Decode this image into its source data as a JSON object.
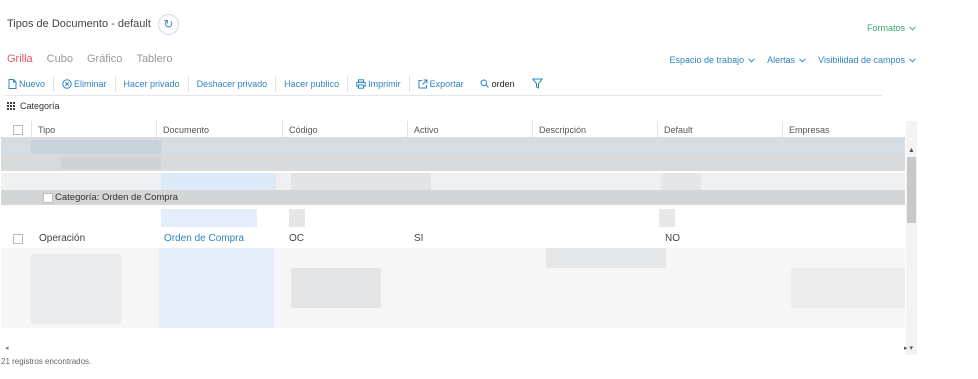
{
  "page": {
    "title": "Tipos de Documento - default",
    "formats_label": "Formatos"
  },
  "view_tabs": [
    "Grilla",
    "Cubo",
    "Gráfico",
    "Tablero"
  ],
  "right_menus": [
    "Espacio de trabajo",
    "Alertas",
    "Visibilidad de campos"
  ],
  "toolbar": {
    "new_label": "Nuevo",
    "delete_label": "Eliminar",
    "make_private_label": "Hacer privado",
    "undo_private_label": "Deshacer privado",
    "make_public_label": "Hacer publico",
    "print_label": "Imprimir",
    "export_label": "Exportar",
    "search_value": "orden"
  },
  "group_bar": {
    "label": "Categoría"
  },
  "grid": {
    "columns": [
      "Tipo",
      "Documento",
      "Código",
      "Activo",
      "Descripción",
      "Default",
      "Empresas"
    ],
    "group_label": "Categoría: Orden de Compra",
    "visible_row": {
      "tipo": "Operación",
      "documento": "Orden de Compra",
      "codigo": "OC",
      "activo": "SI",
      "descripcion": "",
      "default": "NO",
      "empresas": ""
    }
  },
  "footer": {
    "record_count": "21 registros encontrados."
  },
  "colors": {
    "accent_blue": "#2f84c5",
    "active_tab_red": "#e05563",
    "formats_green": "#3aa76d",
    "group_row_gray": "#d3d5d7"
  }
}
